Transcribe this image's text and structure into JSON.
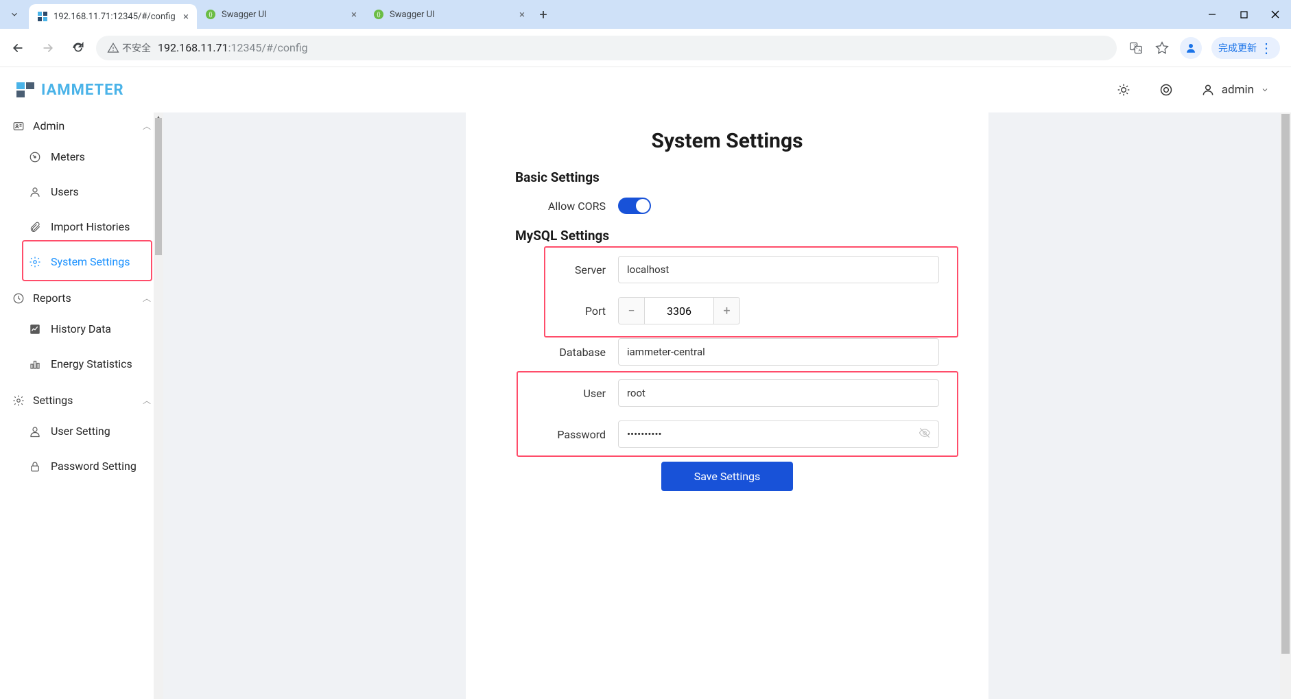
{
  "browser": {
    "tabs": [
      {
        "title": "192.168.11.71:12345/#/config",
        "active": true
      },
      {
        "title": "Swagger UI",
        "active": false
      },
      {
        "title": "Swagger UI",
        "active": false
      }
    ],
    "url_warn": "不安全",
    "url_host": "192.168.11.71",
    "url_port": ":12345",
    "url_path": "/#/config",
    "update_label": "完成更新"
  },
  "header": {
    "brand": "IAMMETER",
    "username": "admin"
  },
  "sidebar": {
    "admin_label": "Admin",
    "items": [
      {
        "label": "Meters"
      },
      {
        "label": "Users"
      },
      {
        "label": "Import Histories"
      },
      {
        "label": "System Settings",
        "active": true
      }
    ],
    "reports_label": "Reports",
    "reports_items": [
      {
        "label": "History Data"
      },
      {
        "label": "Energy Statistics"
      }
    ],
    "settings_label": "Settings",
    "settings_items": [
      {
        "label": "User Setting"
      },
      {
        "label": "Password Setting"
      }
    ]
  },
  "page": {
    "title": "System Settings",
    "basic_section": "Basic Settings",
    "mysql_section": "MySQL Settings",
    "labels": {
      "allow_cors": "Allow CORS",
      "server": "Server",
      "port": "Port",
      "database": "Database",
      "user": "User",
      "password": "Password"
    },
    "values": {
      "server": "localhost",
      "port": "3306",
      "database": "iammeter-central",
      "user": "root",
      "password": "••••••••••"
    },
    "save_button": "Save Settings"
  }
}
